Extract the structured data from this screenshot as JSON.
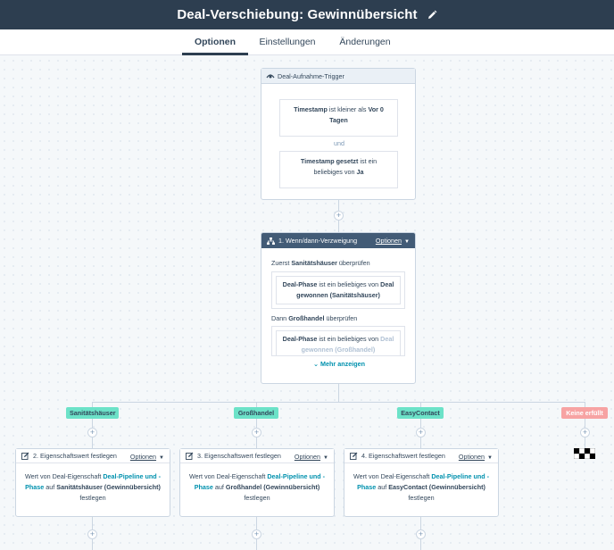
{
  "header": {
    "title": "Deal-Verschiebung: Gewinnübersicht",
    "edit_icon": "pencil-icon"
  },
  "tabs": [
    {
      "label": "Optionen",
      "active": true
    },
    {
      "label": "Einstellungen",
      "active": false
    },
    {
      "label": "Änderungen",
      "active": false
    }
  ],
  "trigger": {
    "title": "Deal-Aufnahme-Trigger",
    "icon": "trigger-icon",
    "cond1": {
      "prop": "Timestamp",
      "op": "ist kleiner als",
      "val": "Vor 0 Tagen"
    },
    "joiner": "und",
    "cond2": {
      "prop": "Timestamp gesetzt",
      "op": "ist ein beliebiges von",
      "val": "Ja"
    }
  },
  "branch": {
    "title": "1. Wenn/dann-Verzweigung",
    "options": "Optionen",
    "first_prefix": "Zuerst",
    "first_name": "Sanitätshäuser",
    "check_suffix": "überprüfen",
    "first_cond": {
      "prop": "Deal-Phase",
      "op": "ist ein beliebiges von",
      "val": "Deal gewonnen (Sanitätshäuser)"
    },
    "second_prefix": "Dann",
    "second_name": "Großhandel",
    "second_cond": {
      "prop": "Deal-Phase",
      "op": "ist ein beliebiges von",
      "val": "Deal gewonnen (Großhandel)"
    },
    "more": "Mehr anzeigen"
  },
  "branch_labels": [
    "Sanitätshäuser",
    "Großhandel",
    "EasyContact",
    "Keine erfüllt"
  ],
  "actions": [
    {
      "title": "2. Eigenschaftswert festlegen",
      "options": "Optionen",
      "text1": "Wert von Deal-Eigenschaft",
      "prop": "Deal-Pipeline und -Phase",
      "text2": "auf",
      "val": "Sanitätshäuser (Gewinnübersicht)",
      "text3": "festlegen"
    },
    {
      "title": "3. Eigenschaftswert festlegen",
      "options": "Optionen",
      "text1": "Wert von Deal-Eigenschaft",
      "prop": "Deal-Pipeline und -Phase",
      "text2": "auf",
      "val": "Großhandel (Gewinnübersicht)",
      "text3": "festlegen"
    },
    {
      "title": "4. Eigenschaftswert festlegen",
      "options": "Optionen",
      "text1": "Wert von Deal-Eigenschaft",
      "prop": "Deal-Pipeline und -Phase",
      "text2": "auf",
      "val": "EasyContact (Gewinnübersicht)",
      "text3": "festlegen"
    }
  ],
  "plus_symbol": "+",
  "colors": {
    "header_bg": "#2d3e50",
    "branch_header": "#425b76",
    "label_teal": "#6ce2c8",
    "label_red": "#f7a3a3",
    "link": "#0091ae"
  }
}
